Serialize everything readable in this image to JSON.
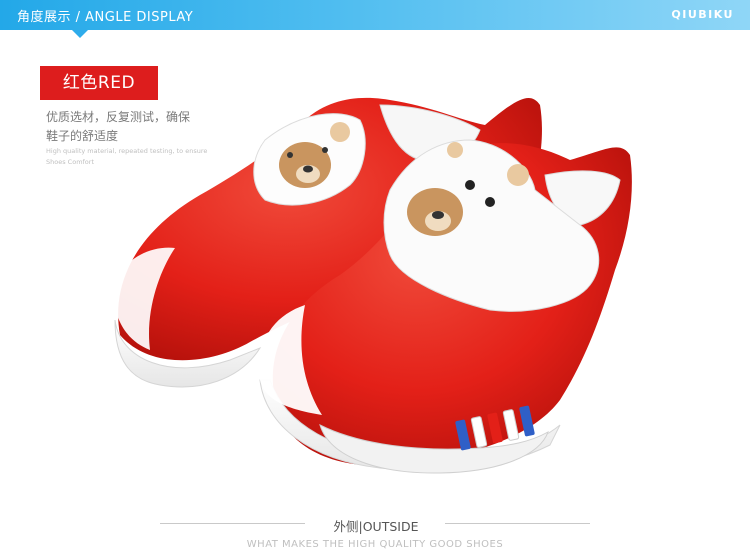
{
  "header": {
    "title": "角度展示  /  ANGLE DISPLAY",
    "brand": "QIUBIKU"
  },
  "product": {
    "color_label": "红色RED",
    "description_cn": [
      "优质选材，反复测试，确保",
      "鞋子的舒适度"
    ],
    "description_en": [
      "High quality material, repeated testing, to ensure",
      "Shoes Comfort"
    ]
  },
  "footer": {
    "view_label": "外侧|OUTSIDE",
    "tagline": "WHAT MAKES THE HIGH QUALITY GOOD SHOES"
  },
  "colors": {
    "header_blue": "#23a8e8",
    "accent_red": "#dd1d1d",
    "shoe_red": "#e32018"
  }
}
